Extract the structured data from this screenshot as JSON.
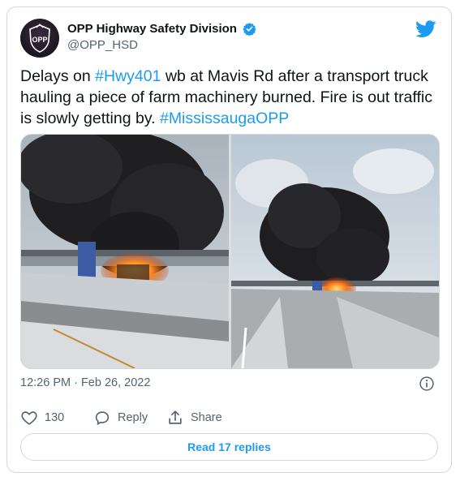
{
  "account": {
    "display_name": "OPP Highway Safety Division",
    "handle": "@OPP_HSD",
    "avatar_badge_text": "OPP",
    "verified": true
  },
  "tweet": {
    "text_parts": [
      {
        "t": "Delays on ",
        "tag": false
      },
      {
        "t": "#Hwy401",
        "tag": true
      },
      {
        "t": " wb at Mavis Rd after a transport truck hauling a piece of farm machinery burned. Fire is out traffic is slowly getting by. ",
        "tag": false
      },
      {
        "t": "#MississaugaOPP",
        "tag": true
      }
    ],
    "timestamp": "12:26 PM · Feb 26, 2022"
  },
  "icons": {
    "brand": "twitter-bird-icon",
    "verified": "verified-badge-icon",
    "info": "info-icon",
    "like": "heart-icon",
    "reply": "reply-bubble-icon",
    "share": "share-icon"
  },
  "actions": {
    "like_count": "130",
    "reply_label": "Reply",
    "share_label": "Share"
  },
  "footer": {
    "read_replies_label": "Read 17 replies"
  },
  "colors": {
    "accent": "#1d9bf0",
    "secondary_text": "#536471",
    "border": "#cfd9de"
  }
}
